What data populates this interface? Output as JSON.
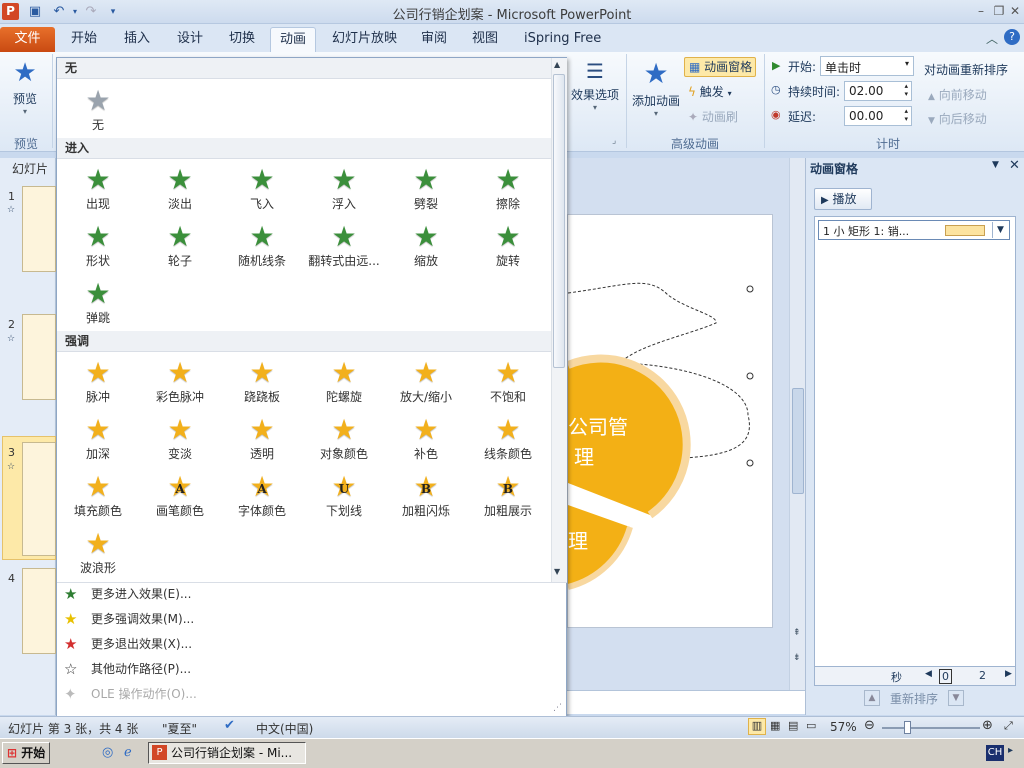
{
  "titlebar": {
    "title": "公司行销企划案 - Microsoft PowerPoint"
  },
  "tabs": [
    {
      "label": "文件"
    },
    {
      "label": "开始"
    },
    {
      "label": "插入"
    },
    {
      "label": "设计"
    },
    {
      "label": "切换"
    },
    {
      "label": "动画"
    },
    {
      "label": "幻灯片放映"
    },
    {
      "label": "审阅"
    },
    {
      "label": "视图"
    },
    {
      "label": "iSpring Free"
    }
  ],
  "ribbon": {
    "preview": {
      "label": "预览",
      "group": "预览"
    },
    "effect_options": "效果选项",
    "add_animation": "添加动画",
    "anim_pane_btn": "动画窗格",
    "trigger": "触发",
    "anim_painter": "动画刷",
    "advanced_group": "高级动画",
    "start_label": "开始:",
    "start_value": "单击时",
    "duration_label": "持续时间:",
    "duration_value": "02.00",
    "delay_label": "延迟:",
    "delay_value": "00.00",
    "timing_group": "计时",
    "reorder_title": "对动画重新排序",
    "move_earlier": "向前移动",
    "move_later": "向后移动"
  },
  "slidepane": {
    "tab": "幻灯片",
    "slides": [
      "1",
      "2",
      "3",
      "4"
    ]
  },
  "gallery": {
    "none_head": "无",
    "none_item": "无",
    "entrance_head": "进入",
    "entrance": [
      "出现",
      "淡出",
      "飞入",
      "浮入",
      "劈裂",
      "擦除",
      "形状",
      "轮子",
      "随机线条",
      "翻转式由远...",
      "缩放",
      "旋转",
      "弹跳"
    ],
    "emphasis_head": "强调",
    "emphasis": [
      "脉冲",
      "彩色脉冲",
      "跷跷板",
      "陀螺旋",
      "放大/缩小",
      "不饱和",
      "加深",
      "变淡",
      "透明",
      "对象颜色",
      "补色",
      "线条颜色",
      "填充颜色",
      "画笔颜色",
      "字体颜色",
      "下划线",
      "加粗闪烁",
      "加粗展示",
      "波浪形"
    ],
    "menu": [
      {
        "label": "更多进入效果(E)...",
        "icon": "green-star-icon"
      },
      {
        "label": "更多强调效果(M)...",
        "icon": "yellow-star-icon"
      },
      {
        "label": "更多退出效果(X)...",
        "icon": "red-star-icon"
      },
      {
        "label": "其他动作路径(P)...",
        "icon": "outline-star-icon"
      },
      {
        "label": "OLE 操作动作(O)...",
        "icon": "ole-icon"
      }
    ]
  },
  "slide": {
    "text1": "公司管",
    "text2": "理",
    "text3": "理"
  },
  "animpane": {
    "title": "动画窗格",
    "play": "播放",
    "item": "1 小 矩形 1: 销...",
    "seconds": "秒",
    "timeline_0": "0",
    "timeline_2": "2",
    "reorder": "重新排序"
  },
  "status": {
    "slide_info": "幻灯片 第 3 张，共 4 张",
    "theme": "\"夏至\"",
    "lang": "中文(中国)",
    "zoom": "57%"
  },
  "taskbar": {
    "start": "开始",
    "task": "公司行销企划案 - Mi...",
    "ime": "CH"
  },
  "colors": {
    "accent_orange": "#f2b01c",
    "file_tab": "#d9571a",
    "entrance_green": "#3b8f3b"
  }
}
